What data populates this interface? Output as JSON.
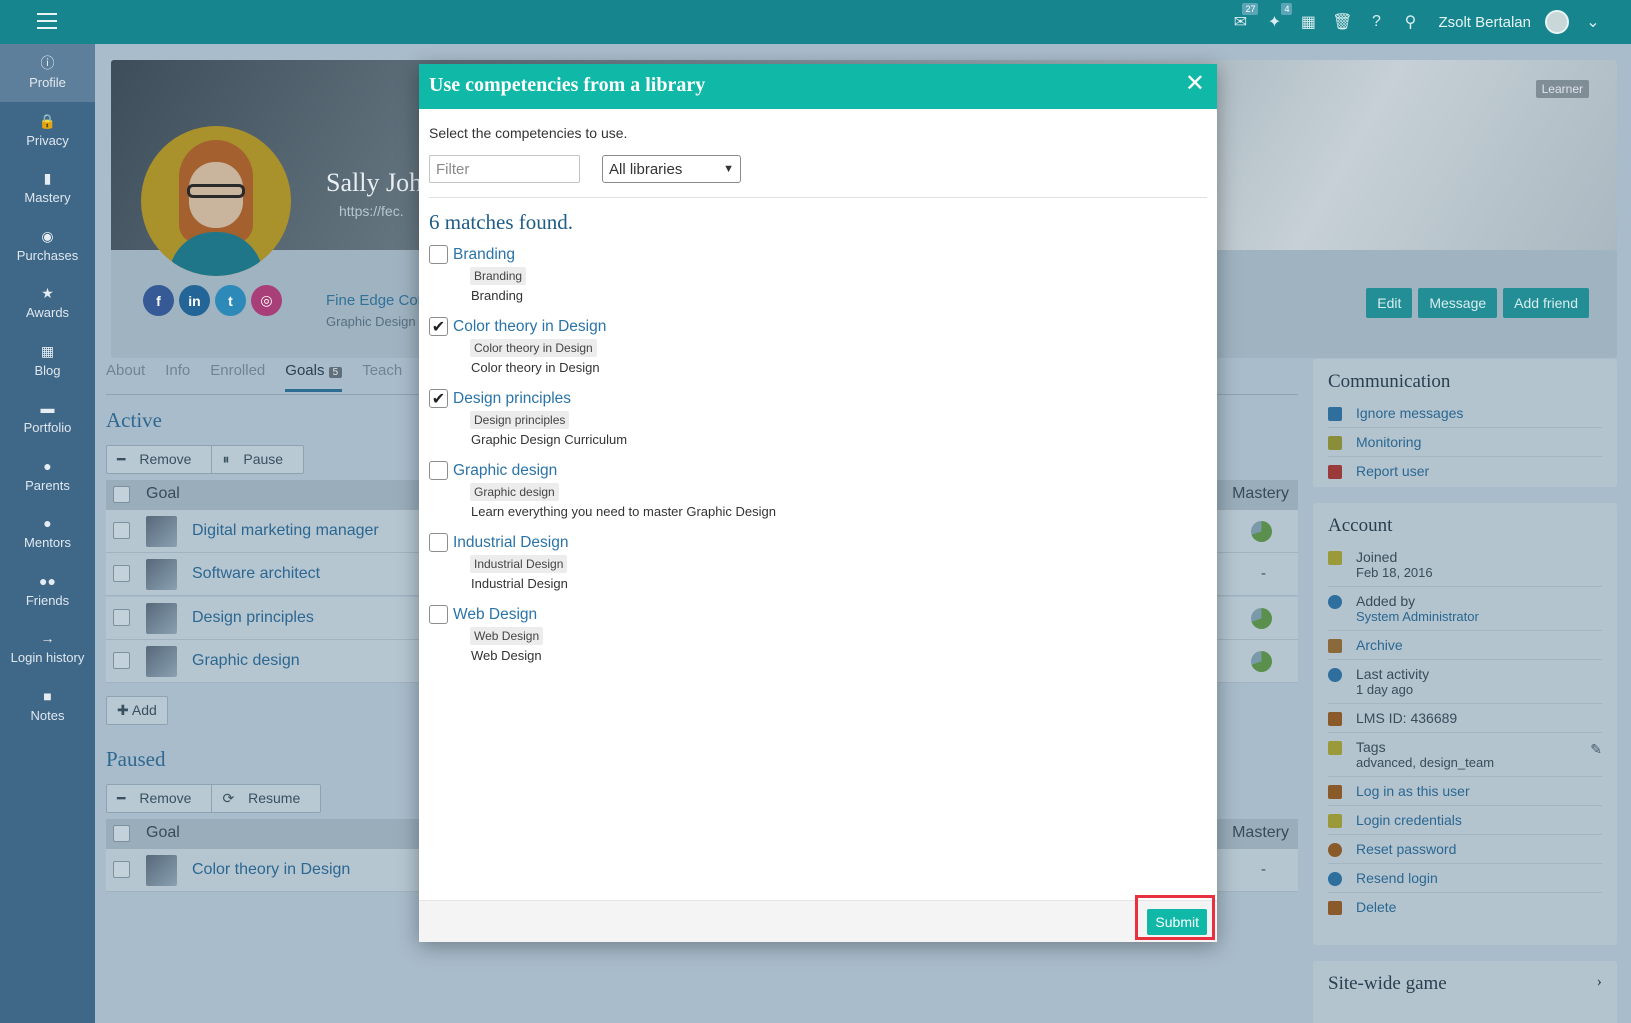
{
  "topbar": {
    "messages_badge": "27",
    "notifications_badge": "4",
    "user_name": "Zsolt Bertalan"
  },
  "sidebar": {
    "items": [
      {
        "label": "Profile",
        "icon": "info-icon",
        "glyph": "ⓘ"
      },
      {
        "label": "Privacy",
        "icon": "lock-icon",
        "glyph": "🔒"
      },
      {
        "label": "Mastery",
        "icon": "bar-chart-icon",
        "glyph": "▮"
      },
      {
        "label": "Purchases",
        "icon": "coins-icon",
        "glyph": "◉"
      },
      {
        "label": "Awards",
        "icon": "star-icon",
        "glyph": "★"
      },
      {
        "label": "Blog",
        "icon": "calendar-icon",
        "glyph": "▦"
      },
      {
        "label": "Portfolio",
        "icon": "folder-icon",
        "glyph": "▬"
      },
      {
        "label": "Parents",
        "icon": "user-icon",
        "glyph": "●"
      },
      {
        "label": "Mentors",
        "icon": "user-icon",
        "glyph": "●"
      },
      {
        "label": "Friends",
        "icon": "users-icon",
        "glyph": "●●"
      },
      {
        "label": "Login history",
        "icon": "arrow-right-icon",
        "glyph": "→"
      },
      {
        "label": "Notes",
        "icon": "note-icon",
        "glyph": "■"
      }
    ]
  },
  "profile": {
    "badge": "Learner",
    "name": "Sally Joh",
    "url": "https://fec.",
    "company": "Fine Edge Cor",
    "company_sub": "Graphic Design",
    "buttons": {
      "edit": "Edit",
      "message": "Message",
      "add_friend": "Add friend"
    }
  },
  "tabs": {
    "about": "About",
    "info": "Info",
    "enrolled": "Enrolled",
    "goals": "Goals",
    "goals_count": "5",
    "teach": "Teach"
  },
  "active": {
    "title": "Active",
    "remove": "Remove",
    "pause": "Pause",
    "col_goal": "Goal",
    "col_mastery": "Mastery",
    "rows": [
      {
        "name": "Digital marketing manager",
        "mastery": "pie"
      },
      {
        "name": "Software architect",
        "mastery": "-"
      },
      {
        "name": "Design principles",
        "mastery": "pie"
      },
      {
        "name": "Graphic design",
        "mastery": "pie"
      }
    ],
    "add": "Add"
  },
  "paused": {
    "title": "Paused",
    "remove": "Remove",
    "resume": "Resume",
    "col_goal": "Goal",
    "col_mastery": "Mastery",
    "rows": [
      {
        "name": "Color theory in Design",
        "mastery": "-"
      }
    ]
  },
  "communication": {
    "title": "Communication",
    "items": [
      "Ignore messages",
      "Monitoring",
      "Report user"
    ]
  },
  "account": {
    "title": "Account",
    "joined_label": "Joined",
    "joined_value": "Feb 18, 2016",
    "added_label": "Added by",
    "added_value": "System Administrator",
    "archive": "Archive",
    "last_activity_label": "Last activity",
    "last_activity_value": "1 day ago",
    "lms_id": "LMS ID: 436689",
    "tags_label": "Tags",
    "tags_value": "advanced, design_team",
    "login_as": "Log in as this user",
    "credentials": "Login credentials",
    "reset_password": "Reset password",
    "resend_login": "Resend login",
    "delete": "Delete"
  },
  "next_panel_title": "Site-wide game",
  "modal": {
    "title": "Use competencies from a library",
    "instructions": "Select the competencies to use.",
    "filter_placeholder": "Filter",
    "library_selected": "All libraries",
    "matches": "6 matches found.",
    "competencies": [
      {
        "name": "Branding",
        "tag": "Branding",
        "description": "Branding",
        "checked": false
      },
      {
        "name": "Color theory in Design",
        "tag": "Color theory in Design",
        "description": "Color theory in Design",
        "checked": true
      },
      {
        "name": "Design principles",
        "tag": "Design principles",
        "description": "Graphic Design Curriculum",
        "checked": true
      },
      {
        "name": "Graphic design",
        "tag": "Graphic design",
        "description": "Learn everything you need to master Graphic Design",
        "checked": false
      },
      {
        "name": "Industrial Design",
        "tag": "Industrial Design",
        "description": "Industrial Design",
        "checked": false
      },
      {
        "name": "Web Design",
        "tag": "Web Design",
        "description": "Web Design",
        "checked": false
      }
    ],
    "submit": "Submit"
  },
  "colors": {
    "topbar": "#17858d",
    "sidebar": "#3f6788",
    "modal_header": "#10b8a8",
    "highlight": "#e8303f"
  }
}
